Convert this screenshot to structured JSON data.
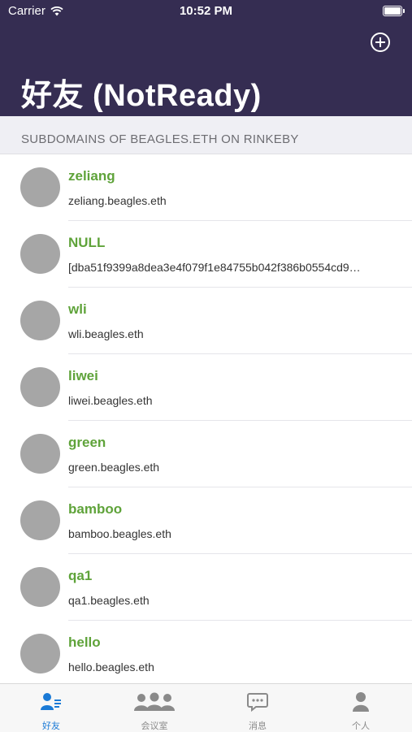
{
  "status_bar": {
    "carrier": "Carrier",
    "time": "10:52 PM"
  },
  "header": {
    "title": "好友 (NotReady)"
  },
  "section": {
    "title": "SUBDOMAINS OF BEAGLES.ETH ON RINKEBY"
  },
  "contacts": [
    {
      "name": "zeliang",
      "subtitle": "zeliang.beagles.eth"
    },
    {
      "name": "NULL",
      "subtitle": "[dba51f9399a8dea3e4f079f1e84755b042f386b0554cd9…"
    },
    {
      "name": "wli",
      "subtitle": "wli.beagles.eth"
    },
    {
      "name": "liwei",
      "subtitle": "liwei.beagles.eth"
    },
    {
      "name": "green",
      "subtitle": "green.beagles.eth"
    },
    {
      "name": "bamboo",
      "subtitle": "bamboo.beagles.eth"
    },
    {
      "name": "qa1",
      "subtitle": "qa1.beagles.eth"
    },
    {
      "name": "hello",
      "subtitle": "hello.beagles.eth"
    }
  ],
  "tabs": [
    {
      "label": "好友",
      "icon": "contacts-icon",
      "active": true
    },
    {
      "label": "会议室",
      "icon": "group-icon",
      "active": false
    },
    {
      "label": "消息",
      "icon": "message-icon",
      "active": false
    },
    {
      "label": "个人",
      "icon": "person-icon",
      "active": false
    }
  ],
  "colors": {
    "header_bg": "#352d52",
    "name_green": "#5fa33a",
    "tab_active": "#1a7ad6",
    "tab_inactive": "#8a8a8a"
  }
}
